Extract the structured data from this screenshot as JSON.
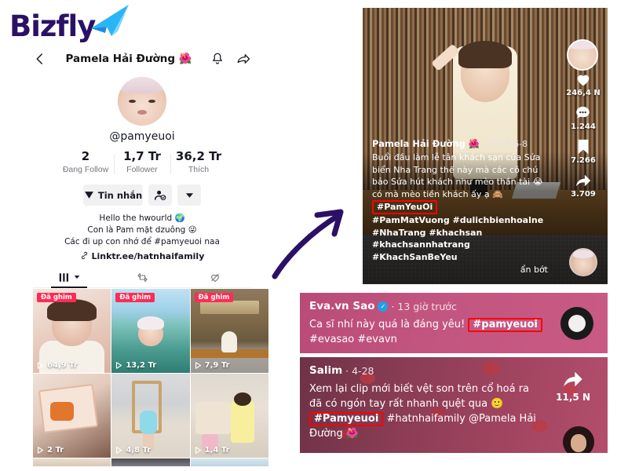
{
  "brand": {
    "name": "Bizfly",
    "logo_color": "#2b1166",
    "plane_color": "#4fc3f7"
  },
  "profile": {
    "topbar": {
      "back_icon": "chevron-left-icon",
      "title": "Pamela Hải Đường 🌺",
      "bell_icon": "bell-icon",
      "share_icon": "share-icon"
    },
    "avatar_name": "profile-avatar",
    "handle": "@pamyeuoi",
    "stats": [
      {
        "num": "2",
        "label": "Đang Follow"
      },
      {
        "num": "1,7 Tr",
        "label": "Follower"
      },
      {
        "num": "36,2 Tr",
        "label": "Thích"
      }
    ],
    "buttons": {
      "message": "Tin nhắn",
      "add_friend_icon": "add-user-icon",
      "caret_icon": "chevron-down-icon"
    },
    "bio_lines": [
      "Hello the hwourld 🌍",
      "Con là Pam mặt dzuông 😜",
      "Các đi up con nhớ để #pamyeuoi naa"
    ],
    "bio_link": "Linktr.ee/hatnhaifamily",
    "tabs": [
      {
        "icon": "grid-icon",
        "active": true
      },
      {
        "icon": "repost-icon",
        "active": false
      },
      {
        "icon": "heart-lock-icon",
        "active": false
      }
    ],
    "grid": [
      {
        "pin": "Đã ghim",
        "views": "64,9 Tr"
      },
      {
        "pin": "Đã ghim",
        "views": "13,2 Tr"
      },
      {
        "pin": "Đã ghim",
        "views": "7,9 Tr"
      },
      {
        "pin": "",
        "views": "2 Tr"
      },
      {
        "pin": "",
        "views": "4,8 Tr"
      },
      {
        "pin": "",
        "views": "1,4 Tr"
      }
    ]
  },
  "arrow": {
    "name": "annotation-arrow",
    "color": "#2b1166"
  },
  "video": {
    "author": "Pamela Hải Đường 🌺",
    "date": "· 2023-6-8",
    "caption": "Buổi đầu làm lễ tân khách sạn của Sứa biển Nha Trang thế này mà các cô chú bảo Sứa hút khách như mèo thần tài 😭 có mà mèo tiền khách ấy ạ 🙈",
    "highlight_tag": "#PamYeuOi",
    "tags_line1": "#PamMatVuong #dulichbienhoalne",
    "tags_line2": "#NhaTrang #khachsan",
    "tags_line3": "#khachsannhatrang #KhachSanBeYeu",
    "show_less": "ẩn bớt",
    "rail": [
      {
        "icon": "heart-icon",
        "count": "246,4 N"
      },
      {
        "icon": "comment-icon",
        "count": "1.244"
      },
      {
        "icon": "bookmark-icon",
        "count": "7.266"
      },
      {
        "icon": "share-arrow-icon",
        "count": "3.709"
      }
    ]
  },
  "comments": [
    {
      "author": "Eva.vn Sao",
      "verified": true,
      "time": "· 13 giờ trước",
      "body_before": "Ca sĩ nhí này quá là đáng yêu! ",
      "highlight": "#pamyeuoi",
      "body_after": " #evasao #evavn",
      "share_count": ""
    },
    {
      "author": "Salim",
      "verified": false,
      "time": "· 4-28",
      "body_before": "Xem lại clip mới biết vệt son trên cổ hoá ra đã có ngón tay rất nhanh quệt qua 🙂 ",
      "highlight": "#Pamyeuoi",
      "body_after": " #hatnhaifamily @Pamela Hải Đường 🌺",
      "share_count": "11,5 N"
    }
  ],
  "highlight_color": "#ff0000"
}
